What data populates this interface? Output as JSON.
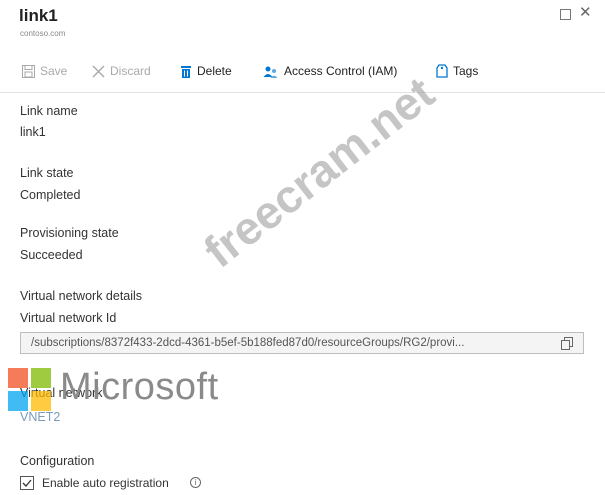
{
  "header": {
    "title": "link1",
    "subtitle": "contoso.com"
  },
  "window": {
    "maximize_icon": "maximize-icon",
    "close_icon": "close-icon"
  },
  "toolbar": {
    "save_label": "Save",
    "discard_label": "Discard",
    "delete_label": "Delete",
    "iam_label": "Access Control (IAM)",
    "tags_label": "Tags"
  },
  "fields": {
    "link_name_label": "Link name",
    "link_name_value": "link1",
    "link_state_label": "Link state",
    "link_state_value": "Completed",
    "provisioning_label": "Provisioning state",
    "provisioning_value": "Succeeded",
    "vnet_details_label": "Virtual network details",
    "vnet_id_label": "Virtual network Id",
    "vnet_id_value": "/subscriptions/8372f433-2dcd-4361-b5ef-5b188fed87d0/resourceGroups/RG2/provi...",
    "vnet_label": "Virtual network",
    "vnet_value": "VNET2",
    "configuration_label": "Configuration",
    "auto_registration_label": "Enable auto registration"
  },
  "overlay": {
    "ms_logo_text": "Microsoft",
    "watermark": "freecram.net"
  },
  "colors": {
    "accent": "#0078d4",
    "disabled": "#a9a9a9"
  }
}
